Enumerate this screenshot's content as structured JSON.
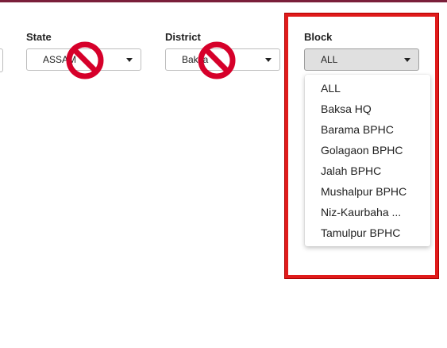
{
  "filters": {
    "state": {
      "label": "State",
      "value": "ASSAM"
    },
    "district": {
      "label": "District",
      "value": "Baksa"
    },
    "block": {
      "label": "Block",
      "value": "ALL",
      "options": [
        "ALL",
        "Baksa HQ",
        "Barama BPHC",
        "Golagaon BPHC",
        "Jalah BPHC",
        "Mushalpur BPHC",
        "Niz-Kaurbaha ...",
        "Tamulpur BPHC"
      ]
    }
  },
  "icons": {
    "state_overlay": "no-entry-icon",
    "district_overlay": "no-entry-icon"
  },
  "colors": {
    "header_bar": "#7a1f3a",
    "highlight_box": "#e01b1b",
    "no_sign": "#d6002a"
  }
}
